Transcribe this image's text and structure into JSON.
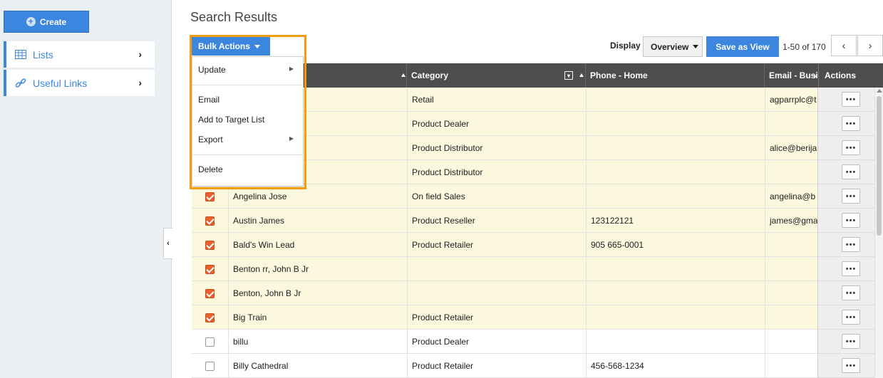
{
  "sidebar": {
    "create_label": "Create",
    "items": [
      {
        "label": "Lists",
        "icon": "grid-icon"
      },
      {
        "label": "Useful Links",
        "icon": "link-icon"
      }
    ]
  },
  "page_title": "Search Results",
  "bulk_actions": {
    "label": "Bulk Actions",
    "menu": [
      "Update",
      "Email",
      "Add to Target List",
      "Export",
      "Delete"
    ]
  },
  "toolbar": {
    "display_label": "Display",
    "display_value": "Overview",
    "save_view_label": "Save as View",
    "pager_text": "1-50 of 170"
  },
  "columns": {
    "category": "Category",
    "phone_home": "Phone - Home",
    "email": "Email - Business",
    "actions": "Actions"
  },
  "rows": [
    {
      "checked": true,
      "name": "",
      "category": "Retail",
      "phone": "",
      "email": "agparrplc@t"
    },
    {
      "checked": true,
      "name": "",
      "category": "Product Dealer",
      "phone": "",
      "email": ""
    },
    {
      "checked": true,
      "name": "",
      "category": "Product Distributor",
      "phone": "",
      "email": "alice@berija"
    },
    {
      "checked": true,
      "name": "",
      "category": "Product Distributor",
      "phone": "",
      "email": ""
    },
    {
      "checked": true,
      "name": "Angelina Jose",
      "category": "On field Sales",
      "phone": "",
      "email": "angelina@b"
    },
    {
      "checked": true,
      "name": "Austin James",
      "category": "Product Reseller",
      "phone": "123122121",
      "email": "james@gma"
    },
    {
      "checked": true,
      "name": "Bald's Win Lead",
      "category": "Product Retailer",
      "phone": "905 665-0001",
      "email": ""
    },
    {
      "checked": true,
      "name": "Benton rr, John B Jr",
      "category": "",
      "phone": "",
      "email": ""
    },
    {
      "checked": true,
      "name": "Benton, John B Jr",
      "category": "",
      "phone": "",
      "email": ""
    },
    {
      "checked": true,
      "name": "Big Train",
      "category": "Product Retailer",
      "phone": "",
      "email": ""
    },
    {
      "checked": false,
      "name": "billu",
      "category": "Product Dealer",
      "phone": "",
      "email": ""
    },
    {
      "checked": false,
      "name": "Billy Cathedral",
      "category": "Product Retailer",
      "phone": "456-568-1234",
      "email": ""
    }
  ],
  "row_action_label": "•••",
  "colors": {
    "accent": "#3d86e0",
    "highlight": "#f39c12",
    "checked_row": "#fbf8dd",
    "checkbox_on": "#e8602c"
  }
}
